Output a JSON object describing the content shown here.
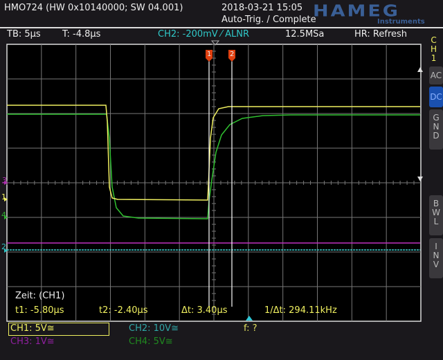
{
  "header": {
    "model": "HMO724 (HW 0x10140000; SW 04.001)",
    "datetime": "2018-03-21 15:05",
    "status": "Auto-Trig. / Complete",
    "logo": "HAMEG",
    "logo_sub": "Instruments"
  },
  "infobar": {
    "timebase": "TB: 5µs",
    "trigger_time": "T: -4.8µs",
    "trigger": "CH2: -200mV ⁄ ALNR",
    "sample_rate": "12.5MSa",
    "mode": "HR: Refresh"
  },
  "sidebar": {
    "channel": "C\nH\n1",
    "ac": "AC",
    "dc": "DC",
    "gnd": "G\nN\nD",
    "bwl": "B\nW\nL",
    "inv": "I\nN\nV"
  },
  "markers": {
    "ch3": "3",
    "ch1": "1",
    "ch4": "4",
    "ch2": "2",
    "cursor1": "1",
    "cursor2": "2"
  },
  "cursor_readout": {
    "title": "Zeit: (CH1)",
    "t1": "t1: -5.80µs",
    "t2": "t2: -2.40µs",
    "dt": "Δt: 3.40µs",
    "inv_dt": "1/Δt: 294.11kHz"
  },
  "channels": {
    "ch1": "CH1: 5V≅",
    "ch2": "CH2: 10V≅",
    "ch3": "CH3: 1V≅",
    "ch4": "CH4: 5V≅",
    "freq": "f: ?"
  },
  "colors": {
    "ch1": "#f0f060",
    "ch2": "#30c0c0",
    "ch3": "#b030b0",
    "ch4": "#30b030",
    "dc_active": "#1a50b0"
  }
}
